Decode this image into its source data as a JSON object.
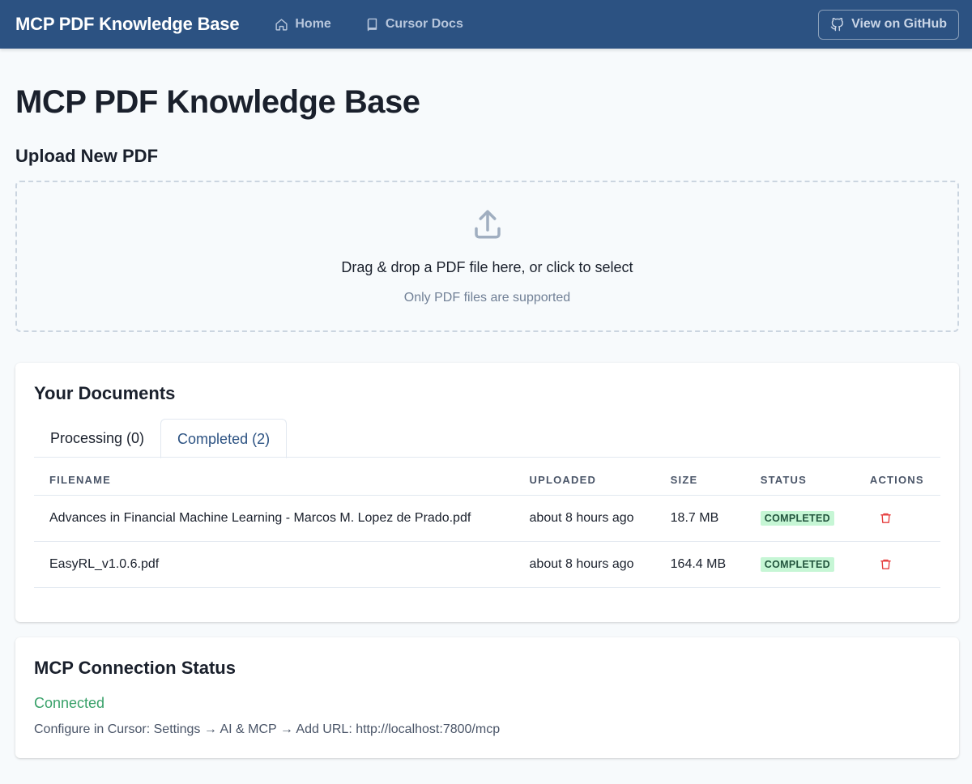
{
  "nav": {
    "brand": "MCP PDF Knowledge Base",
    "links": [
      {
        "label": "Home",
        "icon": "home-icon"
      },
      {
        "label": "Cursor Docs",
        "icon": "book-icon"
      }
    ],
    "github_label": "View on GitHub"
  },
  "page": {
    "title": "MCP PDF Knowledge Base"
  },
  "upload": {
    "title": "Upload New PDF",
    "instruction": "Drag & drop a PDF file here, or click to select",
    "hint": "Only PDF files are supported"
  },
  "documents": {
    "title": "Your Documents",
    "tabs": [
      {
        "label": "Processing (0)",
        "active": false
      },
      {
        "label": "Completed (2)",
        "active": true
      }
    ],
    "columns": [
      "Filename",
      "Uploaded",
      "Size",
      "Status",
      "Actions"
    ],
    "rows": [
      {
        "filename": "Advances in Financial Machine Learning - Marcos M. Lopez de Prado.pdf",
        "uploaded": "about 8 hours ago",
        "size": "18.7 MB",
        "status": "COMPLETED"
      },
      {
        "filename": "EasyRL_v1.0.6.pdf",
        "uploaded": "about 8 hours ago",
        "size": "164.4 MB",
        "status": "COMPLETED"
      }
    ]
  },
  "mcp": {
    "title": "MCP Connection Status",
    "status": "Connected",
    "config": "Configure in Cursor: Settings → AI & MCP → Add URL: http://localhost:7800/mcp"
  },
  "colors": {
    "navbar": "#2c5282",
    "accent": "#2c5282",
    "success": "#38a169",
    "badge_bg": "#c6f6d5",
    "danger": "#e53e3e"
  }
}
